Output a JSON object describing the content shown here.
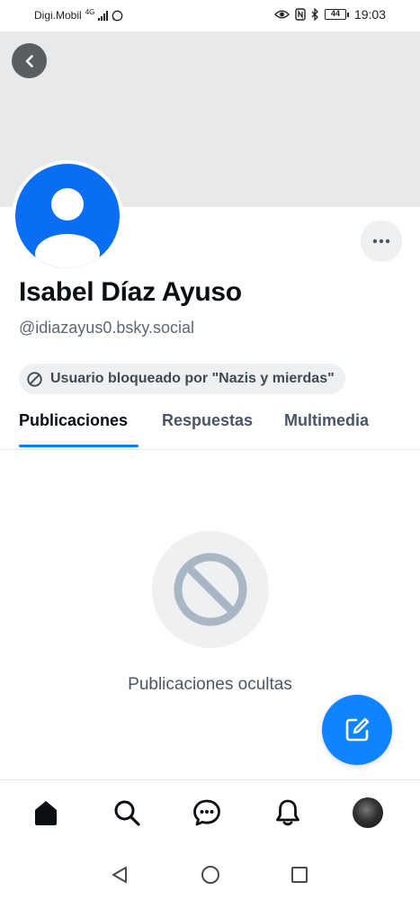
{
  "status_bar": {
    "carrier": "Digi.Mobil",
    "network": "4G",
    "time": "19:03",
    "battery": "44"
  },
  "profile": {
    "display_name": "Isabel Díaz Ayuso",
    "handle": "@idiazayus0.bsky.social",
    "blocked_label": "Usuario bloqueado por \"Nazis y mierdas\""
  },
  "tabs": [
    {
      "label": "Publicaciones",
      "active": true
    },
    {
      "label": "Respuestas",
      "active": false
    },
    {
      "label": "Multimedia",
      "active": false
    }
  ],
  "empty_state": {
    "message": "Publicaciones ocultas"
  },
  "bottom_nav": {
    "items": [
      "home-icon",
      "search-icon",
      "chat-icon",
      "bell-icon",
      "profile-avatar"
    ]
  },
  "system_nav": {
    "items": [
      "back-triangle-icon",
      "home-circle-icon",
      "recents-square-icon"
    ]
  },
  "colors": {
    "accent": "#0a7aff",
    "avatar": "#0a6ef2",
    "fab": "#1083fe",
    "banner": "#e8e9eb"
  }
}
